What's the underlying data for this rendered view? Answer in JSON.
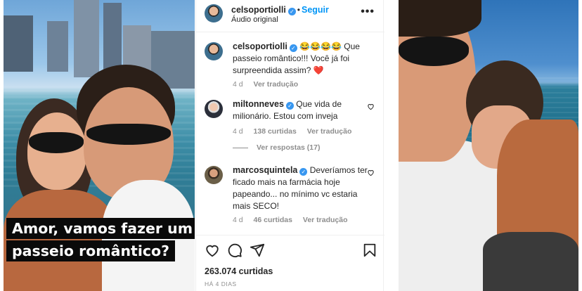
{
  "header": {
    "username": "celsoportiolli",
    "follow_label": "Seguir",
    "audio_label": "Áudio original",
    "more_icon": "more-horizontal-icon"
  },
  "photo_left": {
    "caption_line1": "Amor, vamos fazer um",
    "caption_line2": "passeio romântico?"
  },
  "comments": [
    {
      "username": "celsoportiolli",
      "text_line1": "😂😂😂😂 Que",
      "text_line2": "passeio romântico!!! Você já foi",
      "text_line3": "surpreendida assim? ❤️",
      "time": "4 d",
      "translate": "Ver tradução"
    },
    {
      "username": "miltonneves",
      "text_line1": "Que vida de",
      "text_line2": "milionário. Estou com inveja",
      "time": "4 d",
      "likes": "138 curtidas",
      "translate": "Ver tradução"
    },
    {
      "username": "marcosquintela",
      "text_line1": "Deveríamos ter",
      "text_line2": "ficado mais na farmácia hoje",
      "text_line3": "papeando... no mínimo vc estaria",
      "text_line4": "mais SECO!",
      "time": "4 d",
      "likes": "46 curtidas",
      "translate": "Ver tradução"
    }
  ],
  "replies_label": "Ver respostas (17)",
  "footer": {
    "likes": "263.074 curtidas",
    "date": "HÁ 4 DIAS"
  },
  "colors": {
    "accent": "#0095f6",
    "verified": "#3897f0",
    "muted": "#8e8e8e",
    "heart": "#ed4956"
  }
}
